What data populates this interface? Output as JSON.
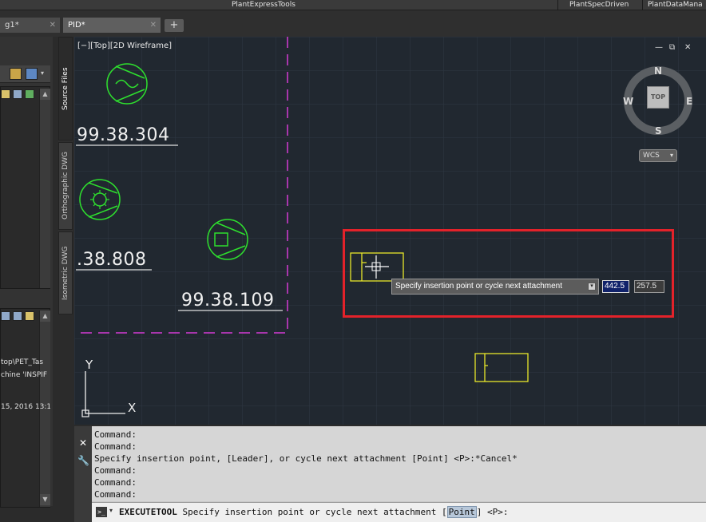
{
  "ribbon": {
    "tabs": [
      "PlantExpressTools",
      "PlantSpecDriven",
      "PlantDataMana"
    ]
  },
  "doc_tabs": [
    {
      "label": "g1*",
      "active": false
    },
    {
      "label": "PID*",
      "active": true
    }
  ],
  "new_tab_label": "+",
  "vertical_tabs": [
    "Source Files",
    "Orthographic DWG",
    "Isometric DWG"
  ],
  "palette": {
    "path_lines": [
      "top\\PET_Tas",
      "chine 'INSPIF",
      "15, 2016 13:1"
    ]
  },
  "viewport": {
    "label": "[−][Top][2D Wireframe]",
    "controls": [
      "—",
      "⧉",
      "✕"
    ]
  },
  "drawing_texts": [
    {
      "id": "tag-304",
      "text": "99.38.304"
    },
    {
      "id": "tag-808",
      "text": ".38.808"
    },
    {
      "id": "tag-109",
      "text": "99.38.109"
    }
  ],
  "tooltip": {
    "prompt": "Specify insertion point or cycle next attachment",
    "x_value": "442.5",
    "y_value": "257.5"
  },
  "viewcube": {
    "north": "N",
    "south": "S",
    "east": "E",
    "west": "W",
    "top": "TOP",
    "wcs": "WCS"
  },
  "ucs": {
    "x": "X",
    "y": "Y"
  },
  "command_line": {
    "history": [
      "Command:",
      "Command:",
      "Specify insertion point, [Leader], or cycle next attachment [Point] <P>:*Cancel*",
      "Command:",
      "Command:",
      "Command:"
    ],
    "prompt_prefix": "EXECUTETOOL",
    "prompt_before": " Specify insertion point or cycle next attachment [",
    "prompt_keyword": "Point",
    "prompt_after": "] <P>:"
  },
  "colors": {
    "canvas_bg": "#212830",
    "symbol_green": "#2ee02e",
    "symbol_yellow": "#e8e82a",
    "boundary_magenta": "#d63ad6",
    "highlight_red": "#e3222a"
  }
}
